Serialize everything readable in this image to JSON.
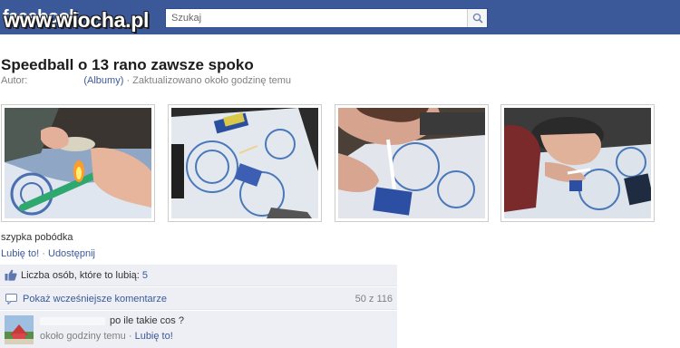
{
  "header": {
    "logo_text": "facebook",
    "watermark_text": "www.wiocha.pl",
    "search": {
      "placeholder": "Szukaj",
      "icon": "search-icon"
    },
    "brand_color": "#3b5998"
  },
  "album": {
    "title": "Speedball o 13 rano zawsze spoko",
    "author_label": "Autor:",
    "albums_link": "(Albumy)",
    "separator": "·",
    "updated_text": "Zaktualizowano około godzinę temu"
  },
  "photos": [
    {
      "name": "photo-1"
    },
    {
      "name": "photo-2"
    },
    {
      "name": "photo-3"
    },
    {
      "name": "photo-4"
    }
  ],
  "caption": "szypka pobódka",
  "actions": {
    "like": "Lubię to!",
    "separator": "·",
    "share": "Udostępnij"
  },
  "feedback": {
    "likes_label": "Liczba osób, które to lubią:",
    "likes_count": "5",
    "show_previous": "Pokaż wcześniejsze komentarze",
    "comment_count": "50 z 116",
    "comments": [
      {
        "text": "po ile takie cos ?",
        "time": "około godziny temu",
        "separator": "·",
        "like": "Lubię to!"
      }
    ]
  }
}
